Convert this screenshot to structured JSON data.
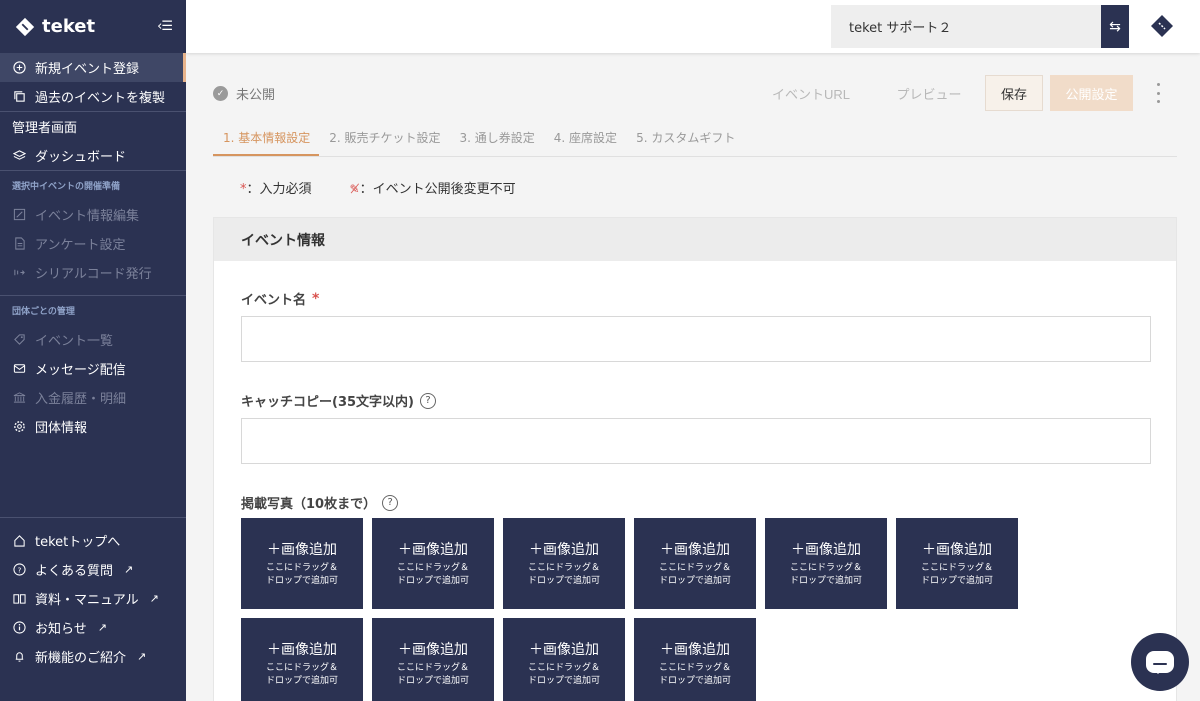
{
  "app": {
    "logo_text": "teket",
    "collapse_label": "‹☰"
  },
  "sidebar": {
    "top_items": [
      {
        "label": "新規イベント登録",
        "icon": "plus-circle-icon"
      },
      {
        "label": "過去のイベントを複製",
        "icon": "copy-icon"
      }
    ],
    "admin_label": "管理者画面",
    "dashboard_label": "ダッシュボード",
    "section_event_prep": "選択中イベントの開催準備",
    "event_prep_items": [
      {
        "label": "イベント情報編集",
        "icon": "pencil-icon"
      },
      {
        "label": "アンケート設定",
        "icon": "document-icon"
      },
      {
        "label": "シリアルコード発行",
        "icon": "serial-icon"
      }
    ],
    "section_org": "団体ごとの管理",
    "org_items": [
      {
        "label": "イベント一覧",
        "icon": "tag-icon"
      },
      {
        "label": "メッセージ配信",
        "icon": "mail-icon"
      },
      {
        "label": "入金履歴・明細",
        "icon": "bank-icon"
      },
      {
        "label": "団体情報",
        "icon": "gear-icon"
      }
    ],
    "bottom_items": [
      {
        "label": "teketトップへ",
        "icon": "home-icon"
      },
      {
        "label": "よくある質問",
        "icon": "question-icon"
      },
      {
        "label": "資料・マニュアル",
        "icon": "book-icon"
      },
      {
        "label": "お知らせ",
        "icon": "info-icon"
      },
      {
        "label": "新機能のご紹介",
        "icon": "bell-icon"
      }
    ]
  },
  "topbar": {
    "org_name": "teket サポート２"
  },
  "main": {
    "status": "未公開",
    "buttons": {
      "event_url": "イベントURL",
      "preview": "プレビュー",
      "save": "保存",
      "publish": "公開設定"
    },
    "tabs": [
      "1. 基本情報設定",
      "2. 販売チケット設定",
      "3. 通し券設定",
      "4. 座席設定",
      "5. カスタムギフト"
    ],
    "legend": {
      "required_mark": "*",
      "required_text": "：入力必須",
      "locked_text": "：イベント公開後変更不可"
    },
    "card_title": "イベント情報",
    "fields": {
      "event_name": "イベント名",
      "catch_copy": "キャッチコピー(35文字以内)",
      "photos": "掲載写真（10枚まで）"
    },
    "photo_tile": {
      "add": "＋画像追加",
      "sub1": "ここにドラッグ＆",
      "sub2": "ドロップで追加可"
    },
    "photo_count": 10
  },
  "colors": {
    "sidebar": "#2b3252",
    "accent": "#d6955f",
    "required": "#d9534f"
  }
}
